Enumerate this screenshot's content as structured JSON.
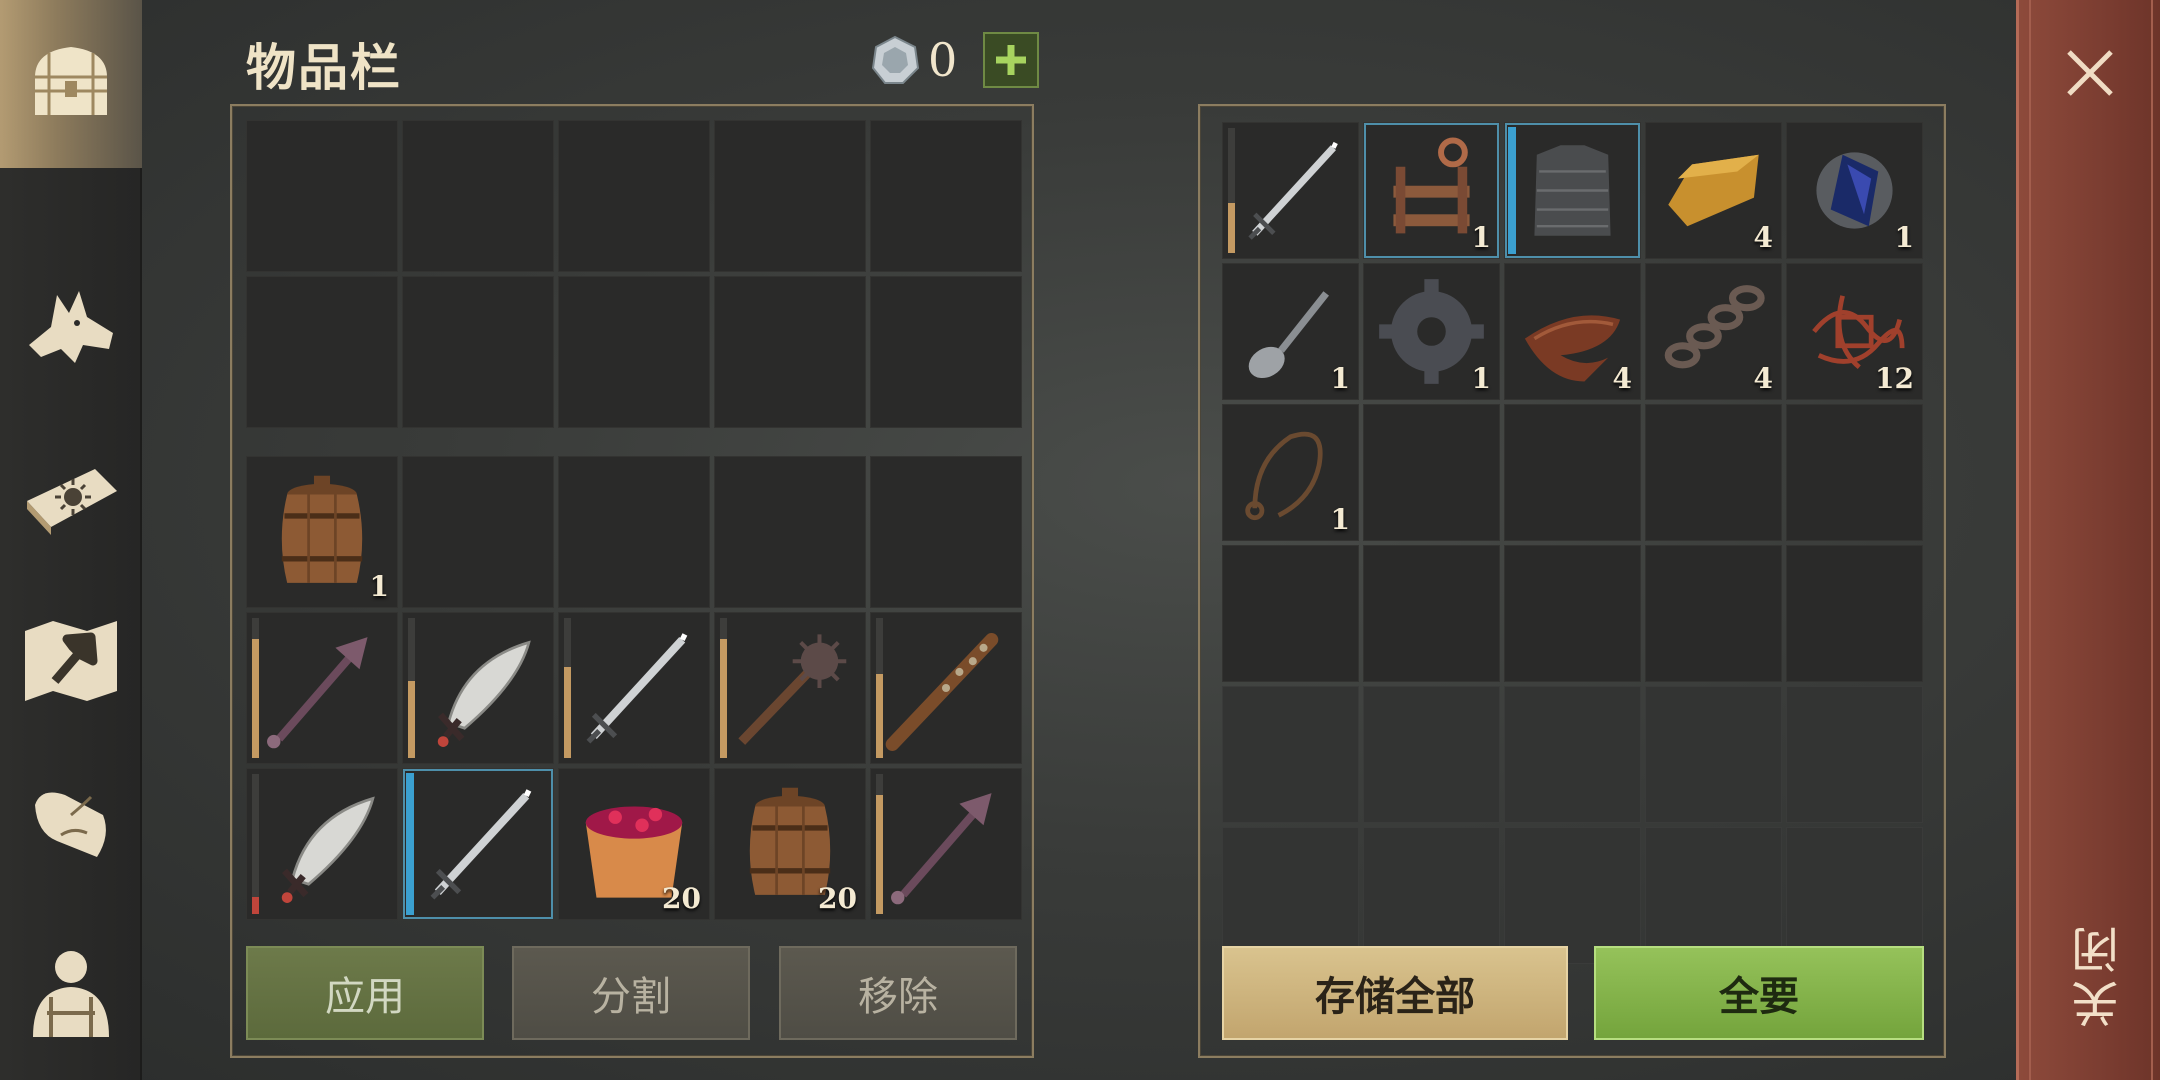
{
  "title": "物品栏",
  "currency": {
    "icon": "silver-coin-icon",
    "value": "0",
    "add_icon": "plus-icon"
  },
  "nav": [
    {
      "icon": "chest-icon",
      "active": true
    },
    {
      "icon": "wolf-icon"
    },
    {
      "icon": "sun-book-icon"
    },
    {
      "icon": "hammer-map-icon"
    },
    {
      "icon": "scroll-quill-icon"
    },
    {
      "icon": "backpack-character-icon"
    }
  ],
  "inventory": {
    "top": [
      {},
      {},
      {},
      {},
      {},
      {},
      {},
      {},
      {},
      {}
    ],
    "main": [
      {
        "icon": "barrel-icon",
        "count": "1"
      },
      {},
      {},
      {},
      {},
      {
        "icon": "spiked-club-icon",
        "durability": 0.85
      },
      {
        "icon": "scimitar-icon",
        "durability": 0.55
      },
      {
        "icon": "sword-icon",
        "durability": 0.65
      },
      {
        "icon": "morning-star-icon",
        "durability": 0.85
      },
      {
        "icon": "wooden-club-icon",
        "durability": 0.6
      },
      {
        "icon": "scimitar-icon",
        "durability": 0.12,
        "durability_color": "#c0453b"
      },
      {
        "icon": "sword-icon",
        "rarity": "blue",
        "selected": true
      },
      {
        "icon": "berry-bucket-icon",
        "count": "20"
      },
      {
        "icon": "barrel-icon",
        "count": "20"
      },
      {
        "icon": "spiked-club-icon",
        "durability": 0.85
      }
    ]
  },
  "left_buttons": {
    "apply": "应用",
    "split": "分割",
    "remove": "移除"
  },
  "storage": {
    "slots": [
      {
        "icon": "sword-icon",
        "durability": 0.4
      },
      {
        "icon": "mechanism-icon",
        "count": "1",
        "selected": true
      },
      {
        "icon": "chainmail-icon",
        "rarity": "blue",
        "selected": true
      },
      {
        "icon": "gold-bar-icon",
        "count": "4"
      },
      {
        "icon": "crystal-icon",
        "count": "1"
      },
      {
        "icon": "spoon-icon",
        "count": "1"
      },
      {
        "icon": "gear-icon",
        "count": "1"
      },
      {
        "icon": "leather-icon",
        "count": "4"
      },
      {
        "icon": "chain-icon",
        "count": "4"
      },
      {
        "icon": "tangled-wire-icon",
        "count": "12"
      },
      {
        "icon": "rope-icon",
        "count": "1"
      },
      {},
      {},
      {},
      {},
      {},
      {},
      {},
      {},
      {},
      {
        "dim": true
      },
      {
        "dim": true
      },
      {
        "dim": true
      },
      {
        "dim": true
      },
      {
        "dim": true
      },
      {
        "dim": true
      },
      {
        "dim": true
      },
      {
        "dim": true
      },
      {
        "dim": true
      },
      {
        "dim": true
      }
    ]
  },
  "right_buttons": {
    "store_all": "存储全部",
    "take_all": "全要"
  },
  "close": {
    "label": "关闭",
    "icon": "close-icon"
  },
  "colors": {
    "rarity_blue": "#3ba0d0",
    "durability": "#c49a62",
    "accent_green": "#9ccf62"
  }
}
